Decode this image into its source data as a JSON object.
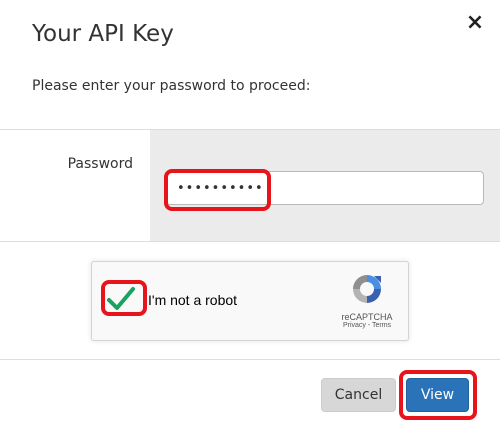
{
  "dialog": {
    "title": "Your API Key",
    "close_glyph": "×",
    "intro": "Please enter your password to proceed:"
  },
  "password_field": {
    "label": "Password",
    "value": "••••••••••"
  },
  "captcha": {
    "checked": true,
    "label": "I'm not a robot",
    "brand": "reCAPTCHA",
    "links": "Privacy - Terms"
  },
  "footer": {
    "cancel_label": "Cancel",
    "view_label": "View"
  },
  "colors": {
    "highlight": "#e8141c",
    "primary_button": "#2a73b8",
    "secondary_button": "#d7d7d7",
    "form_band": "#ebebeb",
    "checkmark": "#1aa260"
  },
  "icons": {
    "close": "close-icon",
    "check": "checkmark-icon",
    "recaptcha_logo": "recaptcha-logo-icon"
  }
}
